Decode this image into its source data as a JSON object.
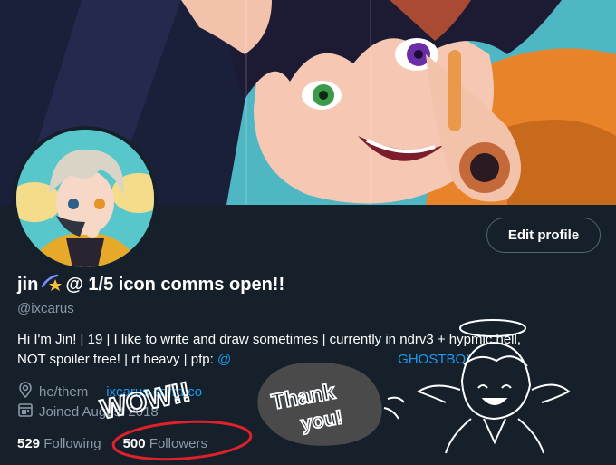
{
  "profile": {
    "display_name_prefix": "jin",
    "display_name_suffix": "@ 1/5 icon comms open!!",
    "handle": "@ixcarus_",
    "bio_line1": "Hi I'm Jin! | 19 | I like to write and draw sometimes | currently in ndrv3 + hypmic hell,",
    "bio_line2_text": "NOT spoiler free! | rt heavy | pfp: ",
    "bio_line2_link_start": "@",
    "bio_line2_link_end": "GHOSTBOX__",
    "location": "he/them",
    "website": "ixcarus.carrd.co",
    "joined": "Joined August 2018",
    "following_count": "529",
    "following_label": "Following",
    "followers_count": "500",
    "followers_label": "Followers"
  },
  "buttons": {
    "edit_profile": "Edit profile"
  },
  "icons": {
    "location": "location-pin-icon",
    "calendar": "calendar-icon",
    "emoji": "dizzy-star-emoji-icon"
  },
  "doodles": {
    "wow": "WOW!!",
    "thank_line1": "Thank",
    "thank_line2": "you!"
  },
  "colors": {
    "background": "#15202b",
    "link": "#1d9bf0",
    "secondary_text": "#8b98a5",
    "circle_red": "#e0202a"
  }
}
